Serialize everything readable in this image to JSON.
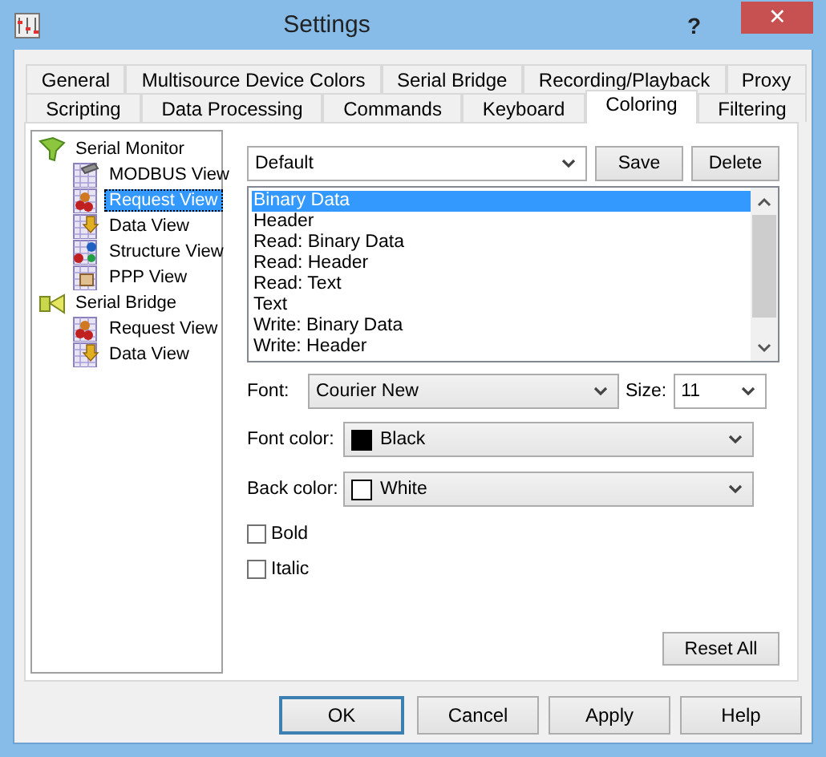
{
  "window": {
    "title": "Settings",
    "help": "?",
    "close": "✕"
  },
  "tab_rows": [
    [
      {
        "label": "General",
        "selected": false
      },
      {
        "label": "Multisource Device Colors",
        "selected": false
      },
      {
        "label": "Serial Bridge",
        "selected": false
      },
      {
        "label": "Recording/Playback",
        "selected": false
      },
      {
        "label": "Proxy",
        "selected": false
      }
    ],
    [
      {
        "label": "Scripting",
        "selected": false
      },
      {
        "label": "Data Processing",
        "selected": false
      },
      {
        "label": "Commands",
        "selected": false
      },
      {
        "label": "Keyboard",
        "selected": false
      },
      {
        "label": "Coloring",
        "selected": true
      },
      {
        "label": "Filtering",
        "selected": false
      }
    ]
  ],
  "tree": [
    {
      "label": "Serial Monitor",
      "kind": "monitor",
      "selected": false,
      "children": [
        {
          "label": "MODBUS View",
          "kind": "modbus",
          "selected": false
        },
        {
          "label": "Request View",
          "kind": "request",
          "selected": true
        },
        {
          "label": "Data View",
          "kind": "data",
          "selected": false
        },
        {
          "label": "Structure View",
          "kind": "structure",
          "selected": false
        },
        {
          "label": "PPP View",
          "kind": "ppp",
          "selected": false
        }
      ]
    },
    {
      "label": "Serial Bridge",
      "kind": "bridge",
      "selected": false,
      "children": [
        {
          "label": "Request View",
          "kind": "request",
          "selected": false
        },
        {
          "label": "Data View",
          "kind": "data",
          "selected": false
        }
      ]
    }
  ],
  "preset": {
    "value": "Default",
    "buttons": [
      "Save",
      "Delete"
    ]
  },
  "elements": [
    {
      "label": "Binary Data",
      "selected": true
    },
    {
      "label": "Header",
      "selected": false
    },
    {
      "label": "Read: Binary Data",
      "selected": false
    },
    {
      "label": "Read: Header",
      "selected": false
    },
    {
      "label": "Read: Text",
      "selected": false
    },
    {
      "label": "Text",
      "selected": false
    },
    {
      "label": "Write: Binary Data",
      "selected": false
    },
    {
      "label": "Write: Header",
      "selected": false
    }
  ],
  "font": {
    "label": "Font:",
    "value": "Courier New",
    "size_label": "Size:",
    "size": "11"
  },
  "colors": [
    {
      "label": "Font color:",
      "value": "Black",
      "color": "#000000"
    },
    {
      "label": "Back color:",
      "value": "White",
      "color": "#ffffff"
    }
  ],
  "styles": [
    {
      "label": "Bold",
      "checked": false
    },
    {
      "label": "Italic",
      "checked": false
    }
  ],
  "reset_button": "Reset All",
  "dialog_buttons": [
    "OK",
    "Cancel",
    "Apply",
    "Help"
  ]
}
